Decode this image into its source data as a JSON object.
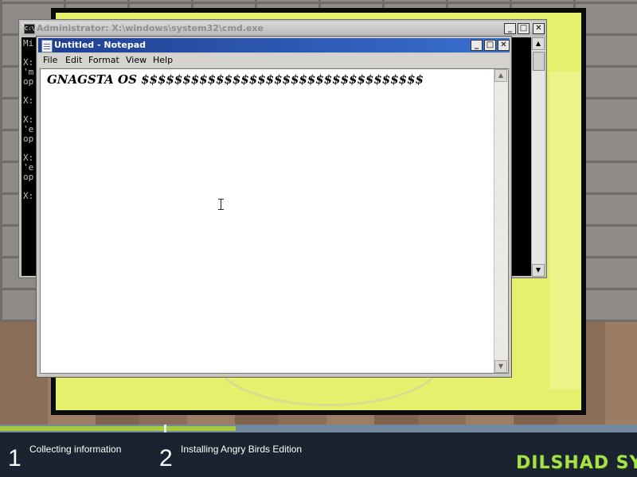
{
  "desktop": {
    "colors": {
      "board_fill": "#e5f06c",
      "progress_fill": "#a6c93d",
      "progress_track": "#73879f"
    }
  },
  "cmd_window": {
    "title": "Administrator: X:\\windows\\system32\\cmd.exe",
    "icon": "console-icon",
    "buttons": {
      "minimize": "_",
      "maximize": "□",
      "close": "✕"
    },
    "console_lines": [
      "Mi",
      "",
      "X:",
      "'m",
      "op",
      "",
      "X:",
      "",
      "X:",
      "'e",
      "op",
      "",
      "X:",
      "'e",
      "op",
      "",
      "X:"
    ]
  },
  "notepad_window": {
    "title": "Untitled - Notepad",
    "icon": "notepad-icon",
    "buttons": {
      "minimize": "_",
      "maximize": "□",
      "close": "✕"
    },
    "menu": [
      "File",
      "Edit",
      "Format",
      "View",
      "Help"
    ],
    "content": "GNAGSTA OS $$$$$$$$$$$$$$$$$$$$$$$$$$$$$$$$$$"
  },
  "setup": {
    "progress_percent": 37,
    "steps": [
      {
        "number": "1",
        "label": "Collecting information"
      },
      {
        "number": "2",
        "label": "Installing Angry Birds Edition"
      }
    ],
    "brand": "DILSHAD SYS"
  }
}
